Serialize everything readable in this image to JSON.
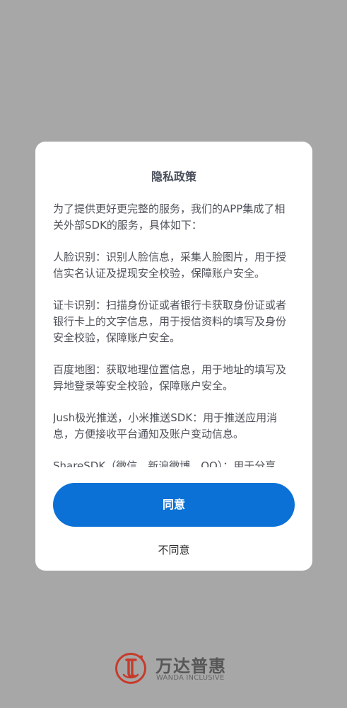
{
  "dialog": {
    "title": "隐私政策",
    "paragraphs": [
      "为了提供更好更完整的服务，我们的APP集成了相关外部SDK的服务，具体如下：",
      "人脸识别：识别人脸信息，采集人脸图片，用于授信实名认证及提现安全校验，保障账户安全。",
      "证卡识别：扫描身份证或者银行卡获取身份证或者银行卡上的文字信息，用于授信资料的填写及身份安全校验，保障账户安全。",
      "百度地图：获取地理位置信息，用于地址的填写及异地登录等安全校验，保障账户安全。",
      "Jush极光推送，小米推送SDK：用于推送应用消息，方便接收平台通知及账户变动信息。",
      "ShareSDK（微信、新浪微博、QQ）：用于分享"
    ],
    "agree_label": "同意",
    "disagree_label": "不同意"
  },
  "brand": {
    "name_cn": "万达普惠",
    "name_en": "WANDA INCLUSIVE",
    "logo_icon": "wanda-logo-icon"
  },
  "colors": {
    "background": "#a7a7a7",
    "dialog_bg": "#ffffff",
    "primary": "#0b71d6",
    "text": "#4f525a",
    "logo_red": "#c63b2a"
  }
}
